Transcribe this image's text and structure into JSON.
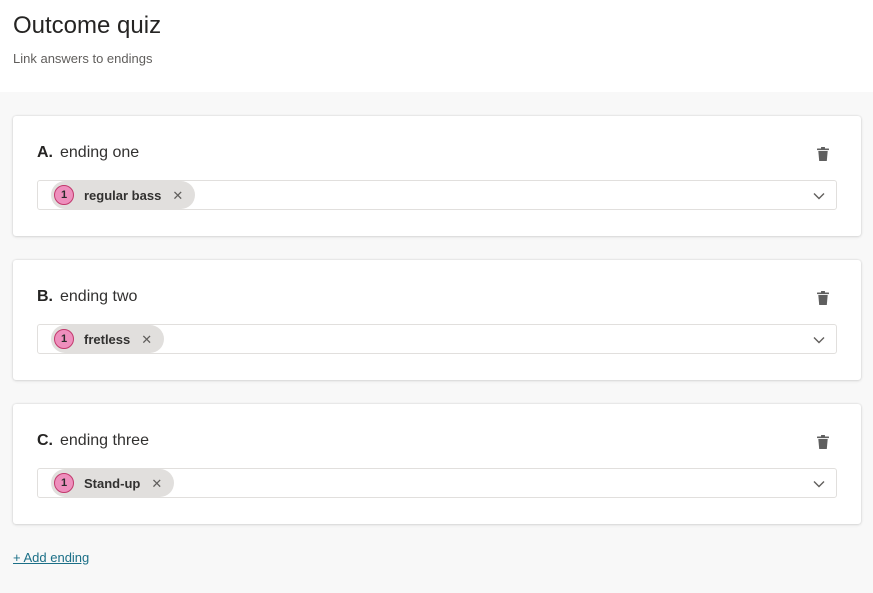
{
  "header": {
    "title": "Outcome quiz",
    "subtitle": "Link answers to endings"
  },
  "endings": [
    {
      "letter": "A.",
      "label": "ending one",
      "answer": {
        "count": "1",
        "text": "regular bass"
      }
    },
    {
      "letter": "B.",
      "label": "ending two",
      "answer": {
        "count": "1",
        "text": "fretless"
      }
    },
    {
      "letter": "C.",
      "label": "ending three",
      "answer": {
        "count": "1",
        "text": "Stand-up"
      }
    }
  ],
  "actions": {
    "add_ending": "+ Add ending"
  },
  "icons": {
    "delete": "trash-icon",
    "remove_chip": "close-icon",
    "dropdown": "chevron-down-icon"
  },
  "colors": {
    "chip_badge": "#ee8fbd",
    "chip_badge_border": "#c2396d",
    "link": "#1b6f87"
  }
}
